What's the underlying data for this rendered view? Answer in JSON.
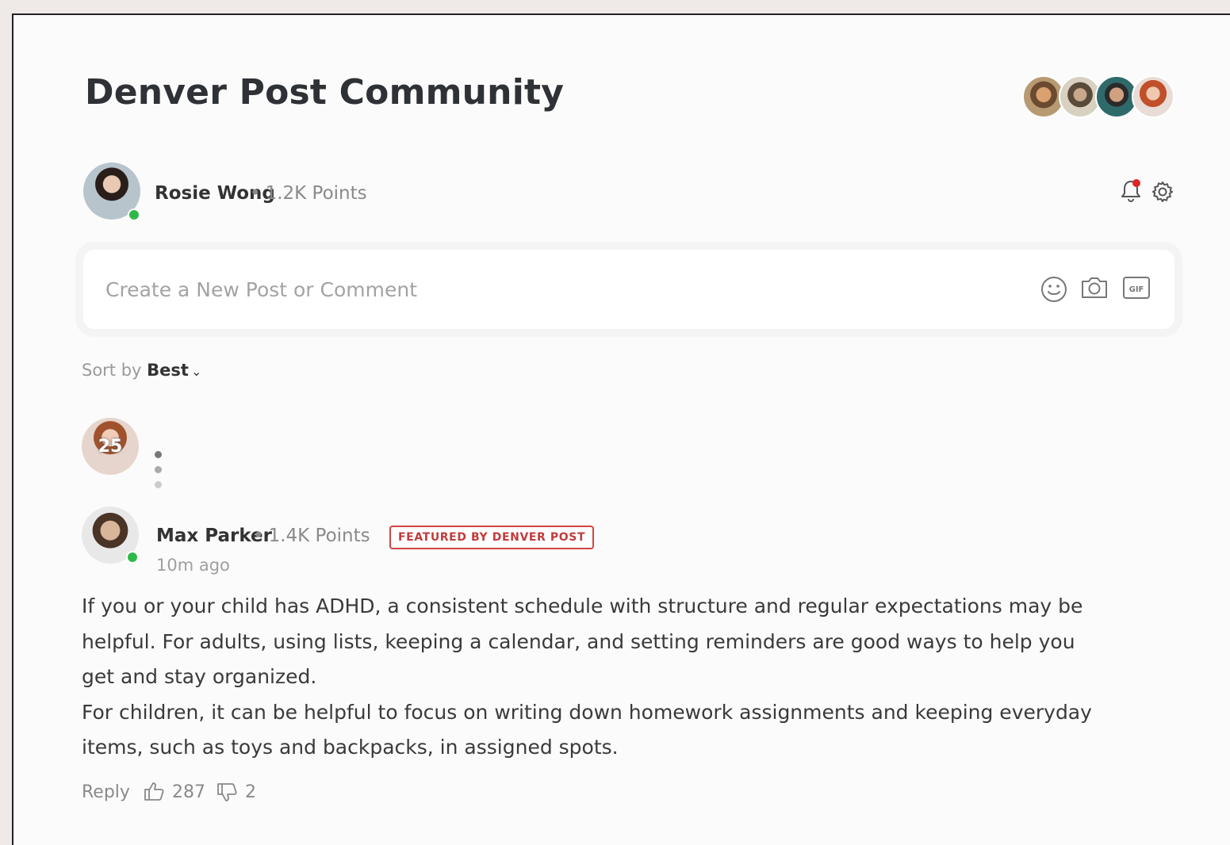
{
  "community": {
    "title": "Denver Post Community",
    "member_avatars": [
      "avatar-1",
      "avatar-2",
      "avatar-3",
      "avatar-4"
    ]
  },
  "current_user": {
    "name": "Rosie Wong",
    "separator": "•",
    "points": "1.2K Points",
    "online": true
  },
  "composer": {
    "placeholder": "Create a New Post or Comment",
    "icons": [
      "emoji-icon",
      "camera-icon",
      "gif-icon"
    ]
  },
  "sort": {
    "label": "Sort by",
    "value": "Best",
    "caret": "⌄"
  },
  "typing": {
    "badge": "25"
  },
  "comment": {
    "author": "Max Parker",
    "separator": "•",
    "points": "1.4K Points",
    "badge": "FEATURED BY DENVER POST",
    "time": "10m ago",
    "paragraph_1": "If you or your child has ADHD, a consistent schedule with structure and regular expectations may be helpful. For adults, using lists, keeping a calendar, and setting reminders are good ways to help you get and stay organized.",
    "paragraph_2": "For children, it can be helpful to focus on writing down homework assignments and keeping everyday items, such as toys and backpacks, in assigned spots.",
    "reply_label": "Reply",
    "likes": "287",
    "dislikes": "2"
  },
  "colors": {
    "accent_red": "#c23b3b",
    "online_green": "#2fb84a",
    "notification_dot": "#e02525"
  }
}
